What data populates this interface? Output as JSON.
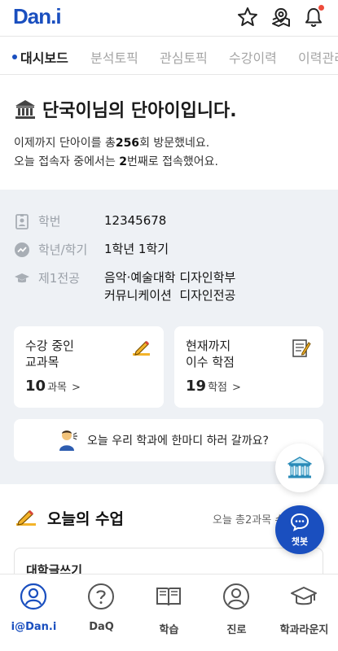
{
  "header": {
    "logo": "Dan.i",
    "icons": [
      "star-icon",
      "location-pin-icon",
      "bell-icon"
    ],
    "notification_dot_color": "#ee4b3b"
  },
  "tabs": [
    {
      "label": "대시보드",
      "active": true
    },
    {
      "label": "분석토픽",
      "active": false
    },
    {
      "label": "관심토픽",
      "active": false
    },
    {
      "label": "수강이력",
      "active": false
    },
    {
      "label": "이력관리",
      "active": false
    }
  ],
  "welcome": {
    "title": "단국이님의 단아이입니다.",
    "line1_prefix": "이제까지 단아이를 총",
    "line1_count": "256",
    "line1_suffix": "회 방문했네요.",
    "line2_prefix": "오늘 접속자 중에서는",
    "line2_count": "2",
    "line2_suffix": "번째로 접속했어요."
  },
  "profile": {
    "student_id_label": "학번",
    "student_id": "12345678",
    "grade_label": "학년/학기",
    "grade": "1학년 1학기",
    "major_label": "제1전공",
    "major_line1": "음악·예술대학 디자인학부",
    "major_line2": "커뮤니케이션  디자인전공"
  },
  "cards": {
    "courses_title_1": "수강 중인",
    "courses_title_2": "교과목",
    "courses_count": "10",
    "courses_unit": "과목",
    "credits_title_1": "현재까지",
    "credits_title_2": "이수 학점",
    "credits_count": "19",
    "credits_unit": "학점",
    "chevron": ">"
  },
  "banner": {
    "text": "오늘 우리 학과에 한마디 하러 갈까요?"
  },
  "today": {
    "title": "오늘의 수업",
    "summary": "오늘 총2과목 수업",
    "class_name": "대학글쓰기"
  },
  "fab": {
    "chat_label": "챗봇"
  },
  "bottom_nav": [
    {
      "label": "i@Dan.i",
      "icon": "person-circle-icon",
      "active": true
    },
    {
      "label": "DaQ",
      "icon": "question-circle-icon",
      "active": false
    },
    {
      "label": "학습",
      "icon": "book-icon",
      "active": false
    },
    {
      "label": "진로",
      "icon": "person-outline-icon",
      "active": false
    },
    {
      "label": "학과라운지",
      "icon": "graduation-cap-icon",
      "active": false
    }
  ],
  "colors": {
    "brand": "#1a4fbf",
    "panel_bg": "#eef1f5",
    "muted": "#9aa0a8"
  }
}
